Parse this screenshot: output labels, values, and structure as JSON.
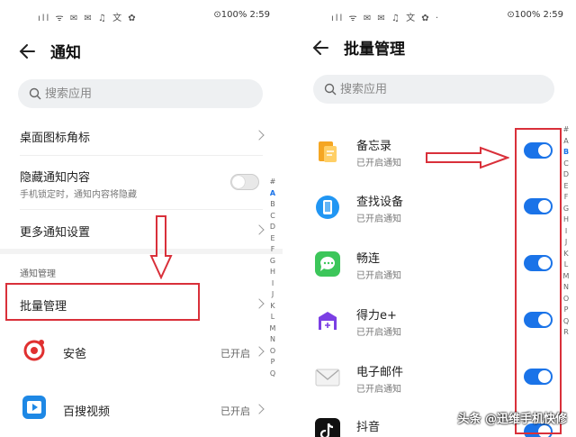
{
  "left": {
    "status": {
      "icons": "ıll ᯤ ✉ ✉ ♫ 文 ✿",
      "battery": "⊙100%",
      "time": "2:59"
    },
    "title": "通知",
    "search_placeholder": "搜索应用",
    "rows": {
      "badge": "桌面图标角标",
      "hide": "隐藏通知内容",
      "hide_sub": "手机锁定时，通知内容将隐藏",
      "more": "更多通知设置",
      "section": "通知管理",
      "batch": "批量管理"
    },
    "apps": [
      {
        "name": "安爸",
        "state": "已开启"
      },
      {
        "name": "百搜视频",
        "state": "已开启"
      }
    ],
    "index": [
      "#",
      "A",
      "B",
      "C",
      "D",
      "E",
      "F",
      "G",
      "H",
      "I",
      "J",
      "K",
      "L",
      "M",
      "N",
      "O",
      "P",
      "Q"
    ],
    "index_active": "A"
  },
  "right": {
    "status": {
      "icons": "ıll ᯤ ✉ ✉ ♫ 文 ✿ ·",
      "battery": "⊙100%",
      "time": "2:59"
    },
    "title": "批量管理",
    "search_placeholder": "搜索应用",
    "apps": [
      {
        "name": "备忘录",
        "sub": "已开启通知",
        "on": true,
        "icon": "memo-icon",
        "color": "#f5a623"
      },
      {
        "name": "查找设备",
        "sub": "已开启通知",
        "on": true,
        "icon": "find-device-icon",
        "color": "#2196f3"
      },
      {
        "name": "畅连",
        "sub": "已开启通知",
        "on": true,
        "icon": "meetime-icon",
        "color": "#3cc65a"
      },
      {
        "name": "得力e+",
        "sub": "已开启通知",
        "on": true,
        "icon": "deli-icon",
        "color": "#7b3fe4"
      },
      {
        "name": "电子邮件",
        "sub": "已开启通知",
        "on": true,
        "icon": "email-icon",
        "color": "#dddddd"
      },
      {
        "name": "抖音",
        "sub": "",
        "on": true,
        "icon": "douyin-icon",
        "color": "#111111"
      }
    ],
    "index": [
      "#",
      "A",
      "B",
      "C",
      "D",
      "E",
      "F",
      "G",
      "H",
      "I",
      "J",
      "K",
      "L",
      "M",
      "N",
      "O",
      "P",
      "Q",
      "R"
    ],
    "index_active": "B"
  },
  "watermark": "头条 @迅维手机快修",
  "colors": {
    "accent": "#1a73e8",
    "annotation": "#d9303a"
  }
}
